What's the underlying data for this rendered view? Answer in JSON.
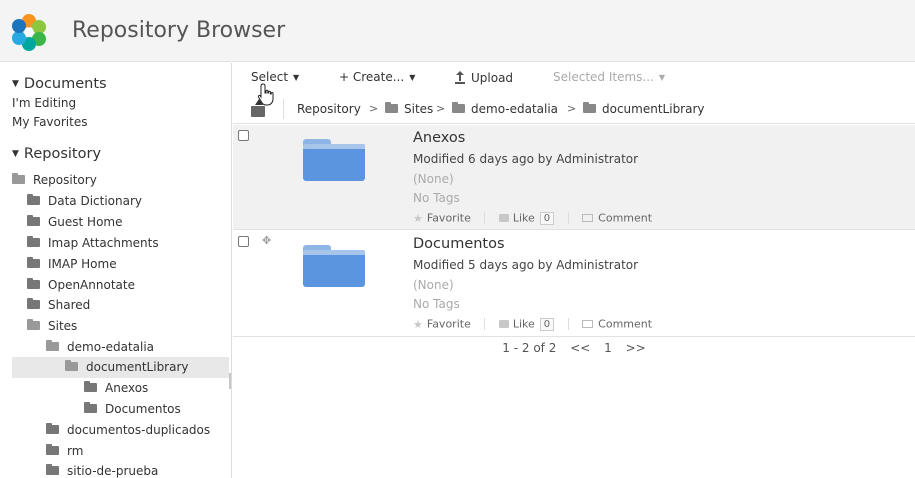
{
  "header": {
    "title": "Repository Browser",
    "logo": "alfresco-flower-logo"
  },
  "sidebar": {
    "documents_heading": "Documents",
    "documents_links": [
      "I'm Editing",
      "My Favorites"
    ],
    "repository_heading": "Repository",
    "tree": [
      {
        "label": "Repository",
        "level": 0
      },
      {
        "label": "Data Dictionary",
        "level": 1
      },
      {
        "label": "Guest Home",
        "level": 1
      },
      {
        "label": "Imap Attachments",
        "level": 1
      },
      {
        "label": "IMAP Home",
        "level": 1
      },
      {
        "label": "OpenAnnotate",
        "level": 1
      },
      {
        "label": "Shared",
        "level": 1
      },
      {
        "label": "Sites",
        "level": 1
      },
      {
        "label": "demo-edatalia",
        "level": 2
      },
      {
        "label": "documentLibrary",
        "level": 3,
        "selected": true
      },
      {
        "label": "Anexos",
        "level": 4
      },
      {
        "label": "Documentos",
        "level": 4
      },
      {
        "label": "documentos-duplicados",
        "level": 2
      },
      {
        "label": "rm",
        "level": 2
      },
      {
        "label": "sitio-de-prueba",
        "level": 2
      }
    ]
  },
  "toolbar": {
    "select_label": "Select",
    "create_label": "+ Create...",
    "upload_label": "Upload",
    "selected_items_label": "Selected Items..."
  },
  "breadcrumb": {
    "items": [
      "Repository",
      "Sites",
      "demo-edatalia",
      "documentLibrary"
    ],
    "separator": ">"
  },
  "items": [
    {
      "name": "Anexos",
      "modified": "Modified 6 days ago by Administrator",
      "description": "(None)",
      "tags": "No Tags",
      "favorite_label": "Favorite",
      "like_label": "Like",
      "like_count": "0",
      "comment_label": "Comment"
    },
    {
      "name": "Documentos",
      "modified": "Modified 5 days ago by Administrator",
      "description": "(None)",
      "tags": "No Tags",
      "favorite_label": "Favorite",
      "like_label": "Like",
      "like_count": "0",
      "comment_label": "Comment"
    }
  ],
  "paginator": {
    "range": "1 - 2 of 2",
    "prev": "<<",
    "page": "1",
    "next": ">>"
  },
  "colors": {
    "folder_blue": "#5b95e0",
    "header_bg": "#f4f4f4",
    "highlight_row": "#f1f1f1",
    "selected_tree": "#e8e8e8"
  }
}
